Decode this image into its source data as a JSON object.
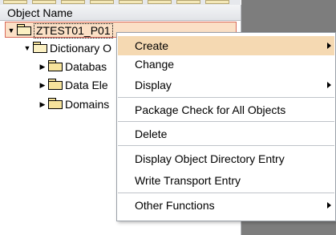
{
  "column_header": "Object Name",
  "tree": {
    "root": {
      "label": "ZTEST01_P01",
      "expanded": true
    },
    "dictionary": {
      "label": "Dictionary O",
      "expanded": true
    },
    "children": [
      {
        "label": "Databas"
      },
      {
        "label": "Data Ele"
      },
      {
        "label": "Domains"
      }
    ]
  },
  "context_menu": {
    "items": [
      {
        "label": "Create",
        "submenu": true
      },
      {
        "label": "Change",
        "submenu": false
      },
      {
        "label": "Display",
        "submenu": true
      },
      {
        "label": "Package Check for All Objects",
        "submenu": false
      },
      {
        "label": "Delete",
        "submenu": false
      },
      {
        "label": "Display Object Directory Entry",
        "submenu": false
      },
      {
        "label": "Write Transport Entry",
        "submenu": false
      },
      {
        "label": "Other Functions",
        "submenu": true
      }
    ]
  }
}
